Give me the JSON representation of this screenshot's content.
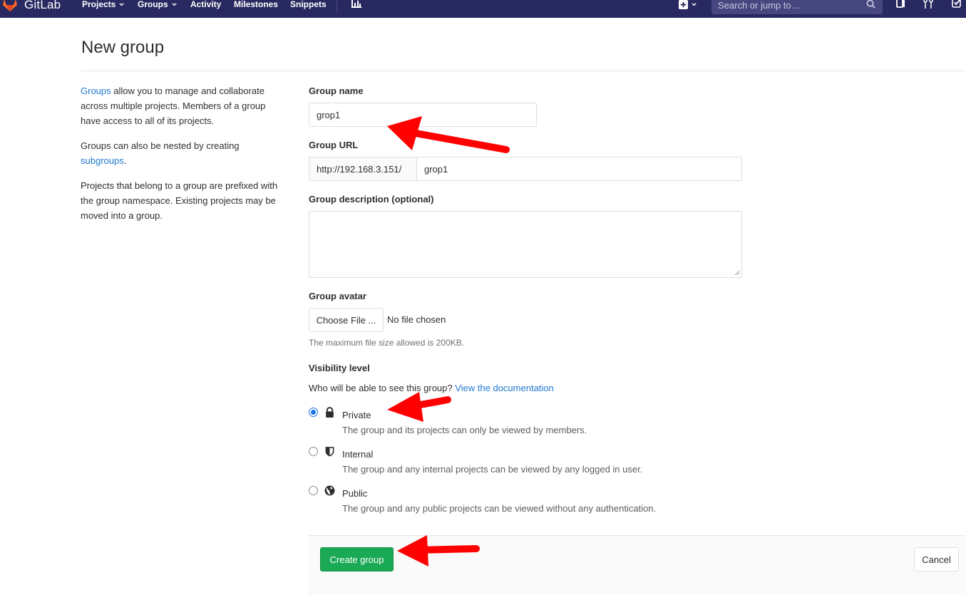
{
  "navbar": {
    "brand": "GitLab",
    "items": [
      {
        "label": "Projects",
        "dropdown": true
      },
      {
        "label": "Groups",
        "dropdown": true
      },
      {
        "label": "Activity",
        "dropdown": false
      },
      {
        "label": "Milestones",
        "dropdown": false
      },
      {
        "label": "Snippets",
        "dropdown": false
      }
    ],
    "icons": [
      "chart-icon",
      "plus-square-icon",
      "issues-icon",
      "merge-request-icon",
      "todo-check-icon"
    ],
    "search_placeholder": "Search or jump to…",
    "background": "#292961"
  },
  "page": {
    "title": "New group"
  },
  "help": {
    "p1_link": "Groups",
    "p1_text": " allow you to manage and collaborate across multiple projects. Members of a group have access to all of its projects.",
    "p2_text": "Groups can also be nested by creating ",
    "p2_link": "subgroups",
    "p2_end": ".",
    "p3_text": "Projects that belong to a group are prefixed with the group namespace. Existing projects may be moved into a group."
  },
  "form": {
    "group_name_label": "Group name",
    "group_name_value": "grop1",
    "group_url_label": "Group URL",
    "group_url_prefix": "http://192.168.3.151/",
    "group_url_value": "grop1",
    "description_label": "Group description (optional)",
    "description_value": "",
    "avatar_label": "Group avatar",
    "choose_file_label": "Choose File ...",
    "file_status": "No file chosen",
    "avatar_hint": "The maximum file size allowed is 200KB.",
    "visibility_label": "Visibility level",
    "visibility_question": "Who will be able to see this group? ",
    "visibility_doc_link": "View the documentation",
    "visibility_options": [
      {
        "name": "Private",
        "icon": "lock-icon",
        "description": "The group and its projects can only be viewed by members.",
        "checked": true
      },
      {
        "name": "Internal",
        "icon": "shield-icon",
        "description": "The group and any internal projects can be viewed by any logged in user.",
        "checked": false
      },
      {
        "name": "Public",
        "icon": "globe-icon",
        "description": "The group and any public projects can be viewed without any authentication.",
        "checked": false
      }
    ],
    "create_button": "Create group",
    "cancel_button": "Cancel"
  },
  "colors": {
    "link": "#1f78d1",
    "primary_button": "#1aaa55",
    "annotation_arrow": "#ff0000"
  }
}
